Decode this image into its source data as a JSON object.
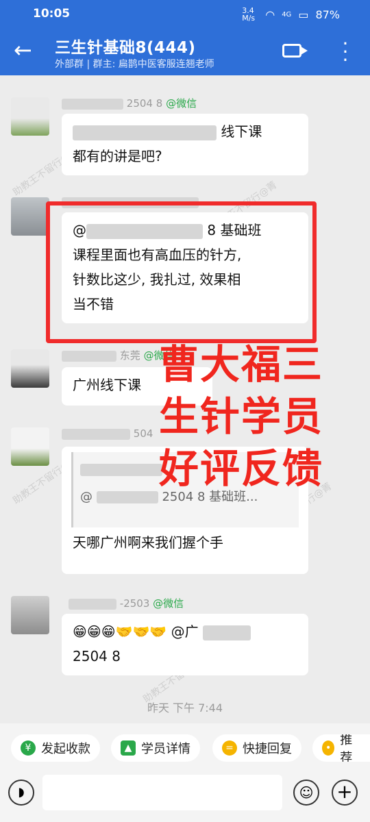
{
  "status": {
    "time": "10:05",
    "speed": "3.4 M/s",
    "network": "4G",
    "battery": "87%"
  },
  "header": {
    "back": "←",
    "title": "三生针基础8(444)",
    "subtitle": "外部群 | 群主: 扁鹊中医客服连翘老师"
  },
  "messages": [
    {
      "sender_visible": "2504 8",
      "sender_source": "@微信",
      "line1_visible": "线下课",
      "line2": "都有的讲是吧?"
    },
    {
      "line1_visible": "8  基础班",
      "line2": "课程里面也有高血压的针方,",
      "line3": "针数比这少, 我扎过, 效果相",
      "line4": "当不错"
    },
    {
      "sender_visible": "东莞",
      "sender_source": "@微信",
      "text_visible": "广州线下课"
    },
    {
      "sender_visible": "504",
      "quote_tag": "2504 8  基础班...",
      "quote_at": "@",
      "text": "天哪广州啊来我们握个手"
    },
    {
      "sender_visible": "-2503",
      "sender_source": "@微信",
      "emojis": "😁😁😁🤝🤝🤝",
      "mention_visible": "@广",
      "line2": "2504 8"
    }
  ],
  "overlay": {
    "line1": "曹大福三",
    "line2": "生针学员",
    "line3": "好评反馈"
  },
  "time_separator": "昨天  下午 7:44",
  "quick_actions": [
    {
      "icon": "¥",
      "label": "发起收款",
      "color": "#2aa84a"
    },
    {
      "icon": "▲",
      "label": "学员详情",
      "color": "#2aa84a"
    },
    {
      "icon": "=",
      "label": "快捷回复",
      "color": "#f5b400"
    },
    {
      "icon": "•",
      "label": "推荐",
      "color": "#f5b400"
    }
  ],
  "watermark": "助教王不留行@菁"
}
